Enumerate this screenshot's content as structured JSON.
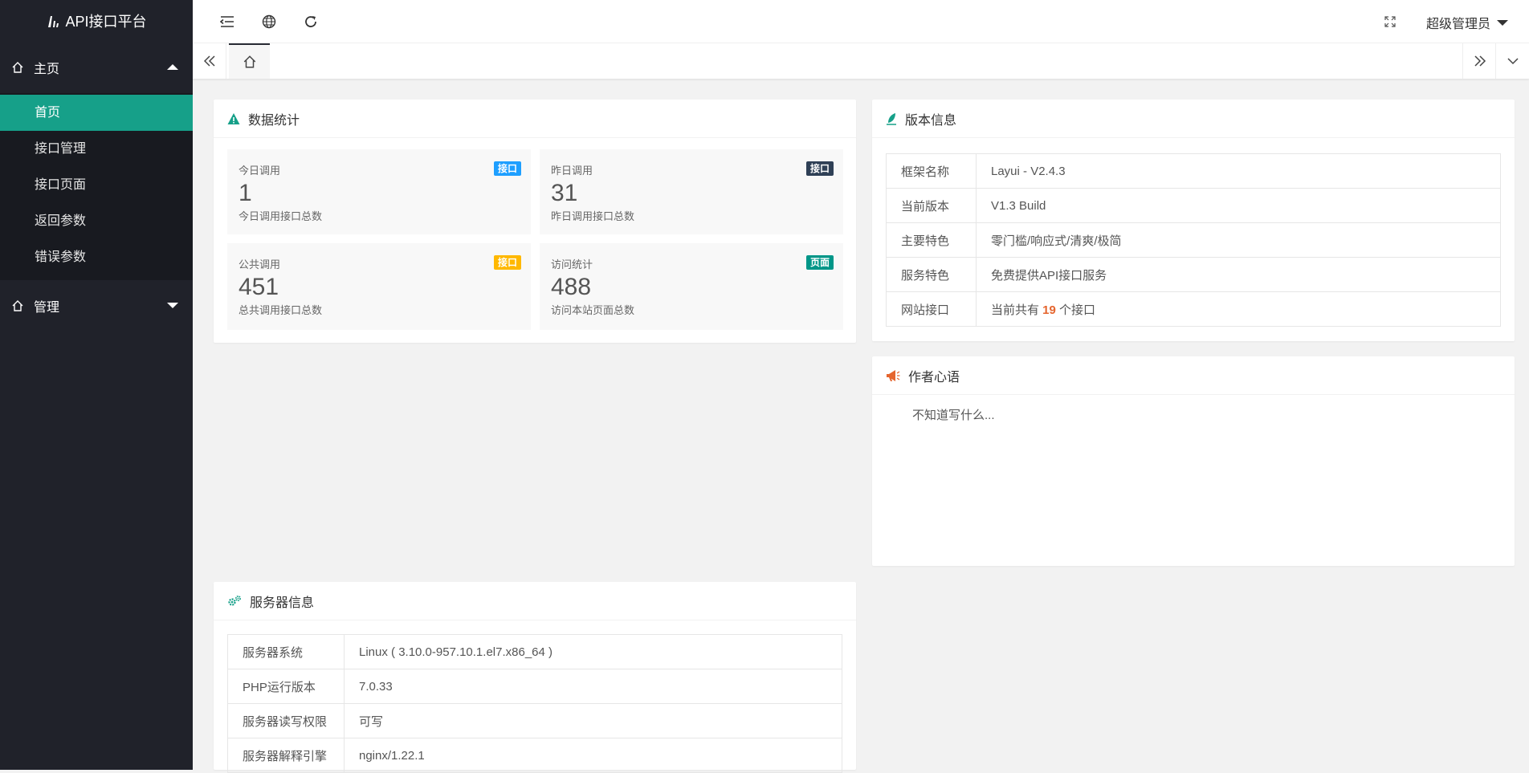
{
  "sidebar": {
    "logo_text": "API接口平台",
    "groups": [
      {
        "label": "主页",
        "items": [
          "首页",
          "接口管理",
          "接口页面",
          "返回参数",
          "错误参数"
        ]
      },
      {
        "label": "管理"
      }
    ]
  },
  "header": {
    "user": "超级管理员"
  },
  "stats_card": {
    "title": "数据统计",
    "boxes": [
      {
        "title": "今日调用",
        "value": "1",
        "desc": "今日调用接口总数",
        "badge": "接口",
        "badge_color": "#1e9fff"
      },
      {
        "title": "昨日调用",
        "value": "31",
        "desc": "昨日调用接口总数",
        "badge": "接口",
        "badge_color": "#2f4056"
      },
      {
        "title": "公共调用",
        "value": "451",
        "desc": "总共调用接口总数",
        "badge": "接口",
        "badge_color": "#ffb800"
      },
      {
        "title": "访问统计",
        "value": "488",
        "desc": "访问本站页面总数",
        "badge": "页面",
        "badge_color": "#009688"
      }
    ]
  },
  "version_card": {
    "title": "版本信息",
    "rows": [
      {
        "k": "框架名称",
        "v": "Layui - V2.4.3"
      },
      {
        "k": "当前版本",
        "v": "V1.3 Build"
      },
      {
        "k": "主要特色",
        "v": "零门槛/响应式/清爽/极简"
      },
      {
        "k": "服务特色",
        "v": "免费提供API接口服务"
      },
      {
        "k": "网站接口",
        "v_prefix": "当前共有 ",
        "v_count": "19",
        "v_suffix": " 个接口"
      }
    ]
  },
  "author_card": {
    "title": "作者心语",
    "text": "不知道写什么..."
  },
  "server_card": {
    "title": "服务器信息",
    "rows": [
      {
        "k": "服务器系统",
        "v": "Linux ( 3.10.0-957.10.1.el7.x86_64 )"
      },
      {
        "k": "PHP运行版本",
        "v": "7.0.33"
      },
      {
        "k": "服务器读写权限",
        "v": "可写"
      },
      {
        "k": "服务器解释引擎",
        "v": "nginx/1.22.1"
      }
    ]
  },
  "colors": {
    "sidebar_bg": "#20222a",
    "active_item": "#16a089",
    "accent_orange": "#e5652e"
  }
}
